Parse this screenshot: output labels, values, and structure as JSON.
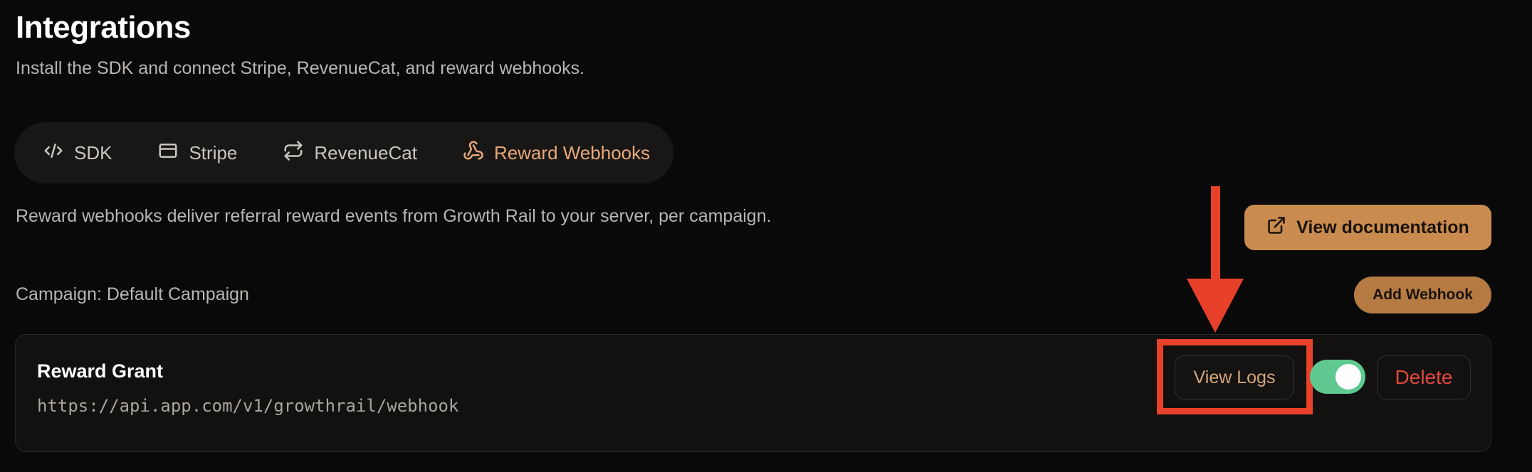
{
  "header": {
    "title": "Integrations",
    "subtitle": "Install the SDK and connect Stripe, RevenueCat, and reward webhooks."
  },
  "tabs": [
    {
      "label": "SDK",
      "icon": "code-icon",
      "active": false
    },
    {
      "label": "Stripe",
      "icon": "credit-card-icon",
      "active": false
    },
    {
      "label": "RevenueCat",
      "icon": "repeat-icon",
      "active": false
    },
    {
      "label": "Reward Webhooks",
      "icon": "webhook-icon",
      "active": true
    }
  ],
  "webhooks_section": {
    "description": "Reward webhooks deliver referral reward events from Growth Rail to your server, per campaign.",
    "docs_button_label": "View documentation",
    "docs_button_icon": "external-link-icon",
    "campaign_label": "Campaign: Default Campaign",
    "add_button_label": "Add Webhook"
  },
  "webhook": {
    "name": "Reward Grant",
    "url": "https://api.app.com/v1/growthrail/webhook",
    "view_logs_label": "View Logs",
    "enabled": true,
    "delete_label": "Delete"
  },
  "colors": {
    "background": "#0a0909",
    "accent": "#c98c4e",
    "active_tab": "#e8a878",
    "toggle_on": "#5fc991",
    "danger": "#e0483e",
    "annotation": "#e8412a"
  }
}
